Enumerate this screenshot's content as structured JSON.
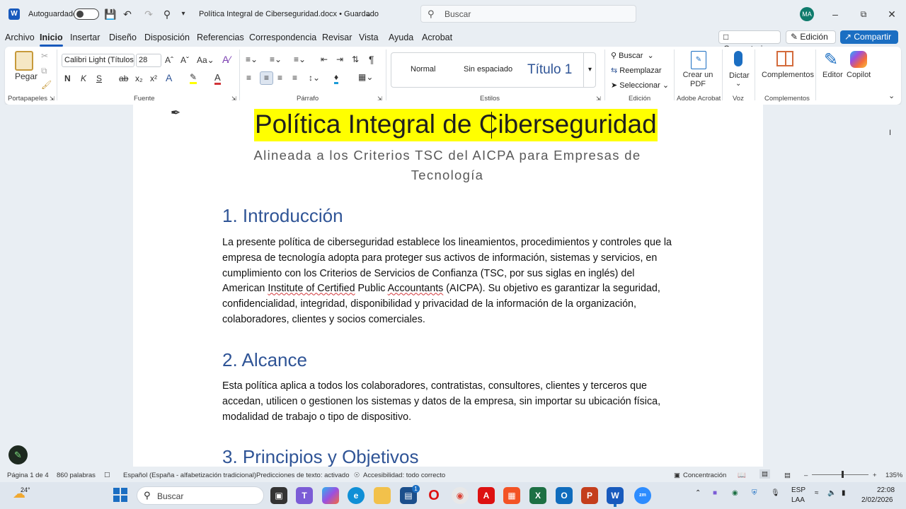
{
  "titlebar": {
    "autosave_label": "Autoguardado",
    "doc_title": "Política Integral de Ciberseguridad.docx • Guardado",
    "search_placeholder": "Buscar",
    "user_initials": "MA"
  },
  "menu": {
    "tabs": [
      "Archivo",
      "Inicio",
      "Insertar",
      "Diseño",
      "Disposición",
      "Referencias",
      "Correspondencia",
      "Revisar",
      "Vista",
      "Ayuda",
      "Acrobat"
    ],
    "active_tab": "Inicio",
    "comments_label": "Comentarios",
    "editing_label": "Edición",
    "share_label": "Compartir"
  },
  "ribbon": {
    "paste_label": "Pegar",
    "font_name": "Calibri Light (Títulos",
    "font_size": "28",
    "styles": [
      "Normal",
      "Sin espaciado",
      "Título 1"
    ],
    "find_label": "Buscar",
    "replace_label": "Reemplazar",
    "select_label": "Seleccionar",
    "create_pdf_label": "Crear un PDF",
    "dictate_label": "Dictar",
    "addins_label": "Complementos",
    "editor_label": "Editor",
    "copilot_label": "Copilot",
    "groups": {
      "clipboard": "Portapapeles",
      "font": "Fuente",
      "paragraph": "Párrafo",
      "styles": "Estilos",
      "editing": "Edición",
      "acrobat": "Adobe Acrobat",
      "voice": "Voz",
      "addins": "Complementos"
    },
    "bold_glyph": "N",
    "italic_glyph": "K",
    "underline_glyph": "S"
  },
  "document": {
    "title": "Política Integral de Ciberseguridad",
    "subtitle": "Alineada a los Criterios TSC del AICPA para Empresas de Tecnología",
    "section1_heading": "1. Introducción",
    "section1_body_a": "La presente política de ciberseguridad establece los lineamientos, procedimientos y controles que la empresa de tecnología adopta para proteger sus activos de información, sistemas y servicios, en cumplimiento con los Criterios de Servicios de Confianza (TSC, por sus siglas en inglés) del American ",
    "section1_body_squig1": "Institute of Certified",
    "section1_body_mid": " Public ",
    "section1_body_squig2": "Accountants",
    "section1_body_b": " (AICPA). Su objetivo es garantizar la seguridad, confidencialidad, integridad, disponibilidad y privacidad de la información de la organización, colaboradores, clientes y socios comerciales.",
    "section2_heading": "2. Alcance",
    "section2_body": "Esta política aplica a todos los colaboradores, contratistas, consultores, clientes y terceros que accedan, utilicen o gestionen los sistemas y datos de la empresa, sin importar su ubicación física, modalidad de trabajo o tipo de dispositivo.",
    "section3_heading": "3. Principios y Objetivos"
  },
  "statusbar": {
    "page": "Página 1 de 4",
    "words": "860 palabras",
    "language": "Español (España - alfabetización tradicional)",
    "predictions": "Predicciones de texto: activado",
    "accessibility": "Accesibilidad: todo correcto",
    "focus": "Concentración",
    "zoom": "135%"
  },
  "taskbar": {
    "weather": "24°",
    "search_placeholder": "Buscar",
    "store_badge": "1",
    "language_top": "ESP",
    "language_bottom": "LAA",
    "time": "22:08",
    "date": "2/02/2026"
  },
  "colors": {
    "accent": "#185abd",
    "heading": "#2f5496",
    "highlight": "#ffff00",
    "share": "#1b6ec2"
  }
}
